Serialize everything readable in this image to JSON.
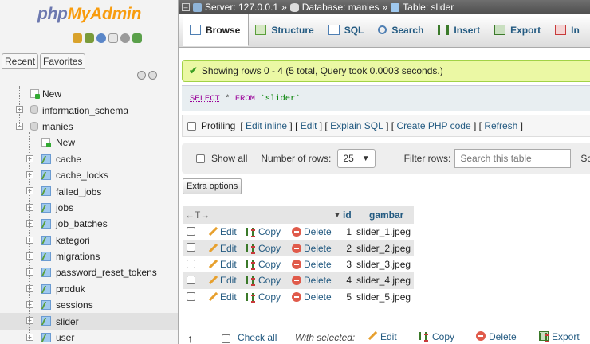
{
  "logo": {
    "part1": "php",
    "part2": "MyAdmin"
  },
  "nav": {
    "tabs": [
      "Recent",
      "Favorites"
    ],
    "tree": [
      {
        "label": "New",
        "type": "new",
        "level": 0
      },
      {
        "label": "information_schema",
        "type": "db",
        "level": 0
      },
      {
        "label": "manies",
        "type": "db",
        "level": 0,
        "expanded": true
      },
      {
        "label": "New",
        "type": "new",
        "level": 1
      },
      {
        "label": "cache",
        "type": "table",
        "level": 1
      },
      {
        "label": "cache_locks",
        "type": "table",
        "level": 1
      },
      {
        "label": "failed_jobs",
        "type": "table",
        "level": 1
      },
      {
        "label": "jobs",
        "type": "table",
        "level": 1
      },
      {
        "label": "job_batches",
        "type": "table",
        "level": 1
      },
      {
        "label": "kategori",
        "type": "table",
        "level": 1
      },
      {
        "label": "migrations",
        "type": "table",
        "level": 1
      },
      {
        "label": "password_reset_tokens",
        "type": "table",
        "level": 1
      },
      {
        "label": "produk",
        "type": "table",
        "level": 1
      },
      {
        "label": "sessions",
        "type": "table",
        "level": 1
      },
      {
        "label": "slider",
        "type": "table",
        "level": 1,
        "active": true
      },
      {
        "label": "user",
        "type": "table",
        "level": 1
      }
    ]
  },
  "breadcrumb": {
    "server": "Server: 127.0.0.1",
    "database": "Database: manies",
    "table": "Table: slider",
    "separator": "»"
  },
  "menu": {
    "tabs": [
      {
        "label": "Browse",
        "active": true,
        "color": "#4f7fb3"
      },
      {
        "label": "Structure",
        "color": "#5a9f3b"
      },
      {
        "label": "SQL",
        "color": "#4f7fb3"
      },
      {
        "label": "Search",
        "color": "#4f7fb3"
      },
      {
        "label": "Insert",
        "color": "#3b7a2a"
      },
      {
        "label": "Export",
        "color": "#3b7a2a"
      },
      {
        "label": "In",
        "color": "#c83a3a"
      }
    ]
  },
  "message": {
    "text": "Showing rows 0 - 4 (5 total, Query took 0.0003 seconds.)"
  },
  "sql": {
    "select": "SELECT",
    "star": "*",
    "from": "FROM",
    "table": "`slider`"
  },
  "profiling": {
    "label": "Profiling",
    "links": [
      "Edit inline",
      "Edit",
      "Explain SQL",
      "Create PHP code",
      "Refresh"
    ]
  },
  "navigation": {
    "show_all": "Show all",
    "rows_label": "Number of rows:",
    "rows_value": "25",
    "filter_label": "Filter rows:",
    "search_placeholder": "Search this table",
    "cut_label": "Sc"
  },
  "extra_options": "Extra options",
  "table": {
    "arrows": "←T→",
    "columns": [
      "id",
      "gambar"
    ],
    "actions": {
      "edit": "Edit",
      "copy": "Copy",
      "delete": "Delete"
    },
    "rows": [
      {
        "id": "1",
        "gambar": "slider_1.jpeg"
      },
      {
        "id": "2",
        "gambar": "slider_2.jpeg"
      },
      {
        "id": "3",
        "gambar": "slider_3.jpeg"
      },
      {
        "id": "4",
        "gambar": "slider_4.jpeg"
      },
      {
        "id": "5",
        "gambar": "slider_5.jpeg"
      }
    ]
  },
  "bottom": {
    "check_all": "Check all",
    "with_selected": "With selected:",
    "edit": "Edit",
    "copy": "Copy",
    "delete": "Delete",
    "export": "Export"
  }
}
